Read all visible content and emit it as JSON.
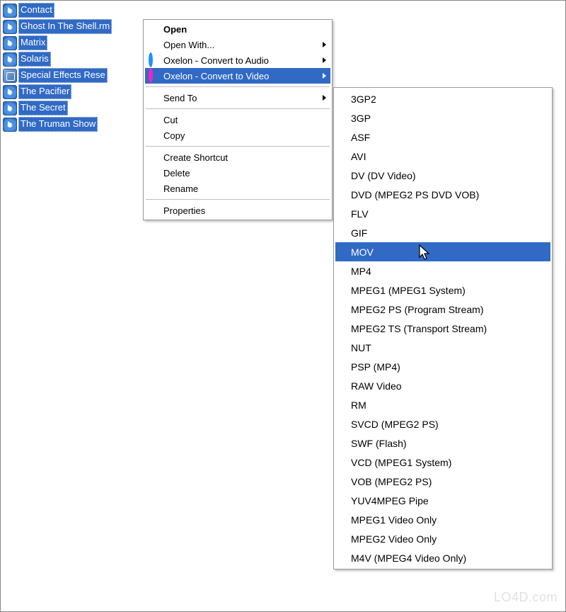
{
  "files": [
    {
      "name": "Contact",
      "icon": "rp"
    },
    {
      "name": "Ghost In The Shell.rm",
      "icon": "rp"
    },
    {
      "name": "Matrix",
      "icon": "rp"
    },
    {
      "name": "Solaris",
      "icon": "rp"
    },
    {
      "name": "Special Effects Rese",
      "icon": "htm"
    },
    {
      "name": "The Pacifier",
      "icon": "rp"
    },
    {
      "name": "The Secret",
      "icon": "rp"
    },
    {
      "name": "The Truman Show",
      "icon": "rp"
    }
  ],
  "context_menu": {
    "open": "Open",
    "open_with": "Open With...",
    "oxelon_audio": "Oxelon - Convert to Audio",
    "oxelon_video": "Oxelon - Convert to Video",
    "send_to": "Send To",
    "cut": "Cut",
    "copy": "Copy",
    "create_shortcut": "Create Shortcut",
    "delete": "Delete",
    "rename": "Rename",
    "properties": "Properties"
  },
  "submenu": {
    "items": [
      "3GP2",
      "3GP",
      "ASF",
      "AVI",
      "DV (DV Video)",
      "DVD (MPEG2 PS DVD VOB)",
      "FLV",
      "GIF",
      "MOV",
      "MP4",
      "MPEG1 (MPEG1 System)",
      "MPEG2 PS (Program Stream)",
      "MPEG2 TS (Transport Stream)",
      "NUT",
      "PSP (MP4)",
      "RAW Video",
      "RM",
      "SVCD (MPEG2 PS)",
      "SWF (Flash)",
      "VCD (MPEG1 System)",
      "VOB (MPEG2 PS)",
      "YUV4MPEG Pipe",
      "MPEG1 Video Only",
      "MPEG2 Video Only",
      "M4V (MPEG4 Video Only)"
    ],
    "highlighted": "MOV"
  },
  "watermark": "LO4D.com"
}
